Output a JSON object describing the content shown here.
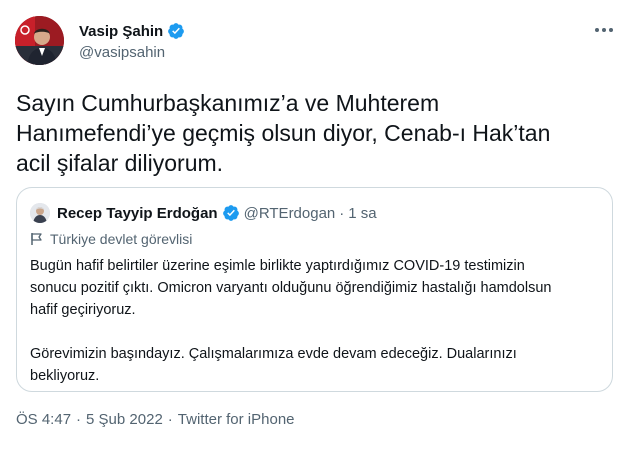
{
  "author": {
    "name": "Vasip Şahin",
    "handle": "@vasipsahin",
    "verified_icon": "verified-badge-icon",
    "avatar_icon": "profile-photo"
  },
  "more_icon": "more-options-icon",
  "tweet": {
    "lines": [
      "Sayın Cumhurbaşkanımız’a ve Muhterem",
      "Hanımefendi’ye geçmiş olsun diyor, Cenab-ı Hak’tan",
      "acil şifalar diliyorum."
    ]
  },
  "quote": {
    "name": "Recep Tayyip Erdoğan",
    "handle": "@RTErdogan",
    "separator": "·",
    "time": "1 sa",
    "label": "Türkiye devlet görevlisi",
    "label_icon": "flag-icon",
    "lines": [
      "Bugün hafif belirtiler üzerine eşimle birlikte yaptırdığımız COVID-19 testimizin",
      "sonucu pozitif çıktı. Omicron varyantı olduğunu öğrendiğimiz hastalığı hamdolsun",
      "hafif geçiriyoruz.",
      "",
      "Görevimizin başındayız. Çalışmalarımıza evde devam edeceğiz. Dualarınızı",
      "bekliyoruz."
    ]
  },
  "meta": {
    "time": "ÖS 4:47",
    "date": "5 Şub 2022",
    "source": "Twitter for iPhone",
    "separator": "·"
  },
  "colors": {
    "text": "#0f1419",
    "secondary": "#536471",
    "verified": "#1d9bf0",
    "border": "#cfd9de"
  }
}
